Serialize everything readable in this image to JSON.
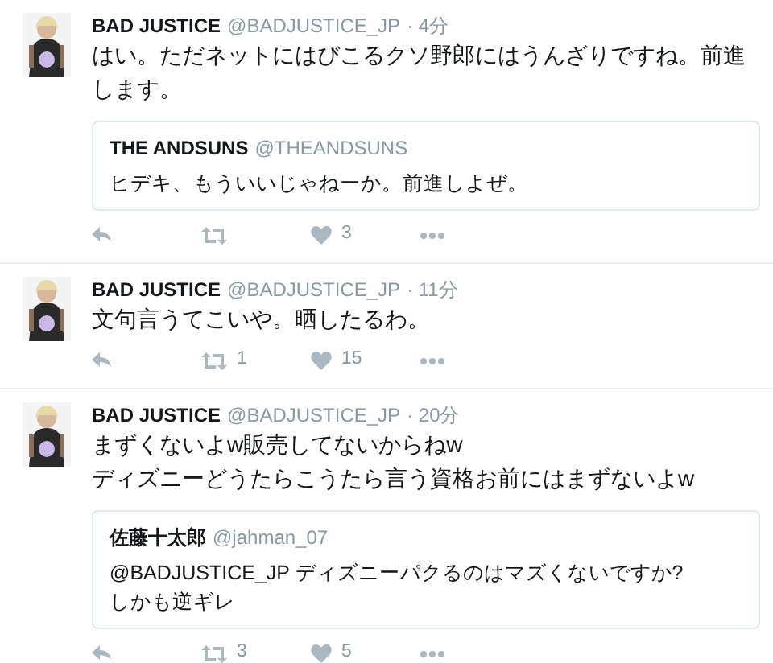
{
  "tweets": [
    {
      "name": "BAD JUSTICE",
      "handle": "@BADJUSTICE_JP",
      "time": "· 4分",
      "text": "はい。ただネットにはびこるクソ野郎にはうんざりですね。前進します。",
      "quote": {
        "name": "THE ANDSUNS",
        "handle": "@THEANDSUNS",
        "text": "ヒデキ、もういいじゃねーか。前進しよぜ。"
      },
      "likes": "3"
    },
    {
      "name": "BAD JUSTICE",
      "handle": "@BADJUSTICE_JP",
      "time": "· 11分",
      "text": "文句言うてこいや。晒したるわ。",
      "retweets": "1",
      "likes": "15"
    },
    {
      "name": "BAD JUSTICE",
      "handle": "@BADJUSTICE_JP",
      "time": "· 20分",
      "text": "まずくないよw販売してないからねw\nディズニーどうたらこうたら言う資格お前にはまずないよw",
      "quote": {
        "name": "佐藤十太郎",
        "handle": "@jahman_07",
        "text": "@BADJUSTICE_JP ディズニーパクるのはマズくないですか?\nしかも逆ギレ"
      },
      "retweets": "3",
      "likes": "5"
    }
  ]
}
